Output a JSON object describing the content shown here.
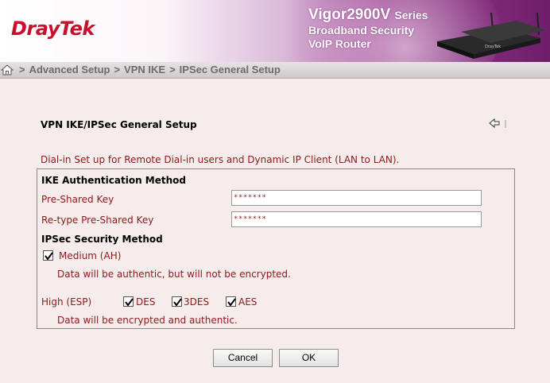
{
  "header": {
    "logo": "DrayTek",
    "product_name": "Vigor2900V",
    "product_series": "Series",
    "product_line1": "Broadband Security",
    "product_line2": "VoIP Router"
  },
  "breadcrumb": {
    "separator": ">",
    "items": [
      "Advanced Setup",
      "VPN IKE",
      "IPSec General Setup"
    ]
  },
  "page": {
    "title": "VPN IKE/IPSec General Setup",
    "intro": "Dial-in Set up for Remote Dial-in users and Dynamic IP Client (LAN to LAN)."
  },
  "ike": {
    "heading": "IKE Authentication Method",
    "psk_label": "Pre-Shared Key",
    "psk_value": "*******",
    "retype_label": "Re-type Pre-Shared Key",
    "retype_value": "*******"
  },
  "ipsec": {
    "heading": "IPSec Security Method",
    "medium_label": "Medium (AH)",
    "medium_checked": true,
    "medium_note": "Data will be authentic, but will not be encrypted.",
    "high_label": "High (ESP)",
    "options": [
      {
        "label": "DES",
        "checked": true
      },
      {
        "label": "3DES",
        "checked": true
      },
      {
        "label": "AES",
        "checked": true
      }
    ],
    "high_note": "Data will be encrypted and authentic."
  },
  "buttons": {
    "cancel": "Cancel",
    "ok": "OK"
  },
  "colors": {
    "label_text": "#8b1a1a",
    "logo": "#c8102e",
    "page_bg": "#f6ecec"
  }
}
